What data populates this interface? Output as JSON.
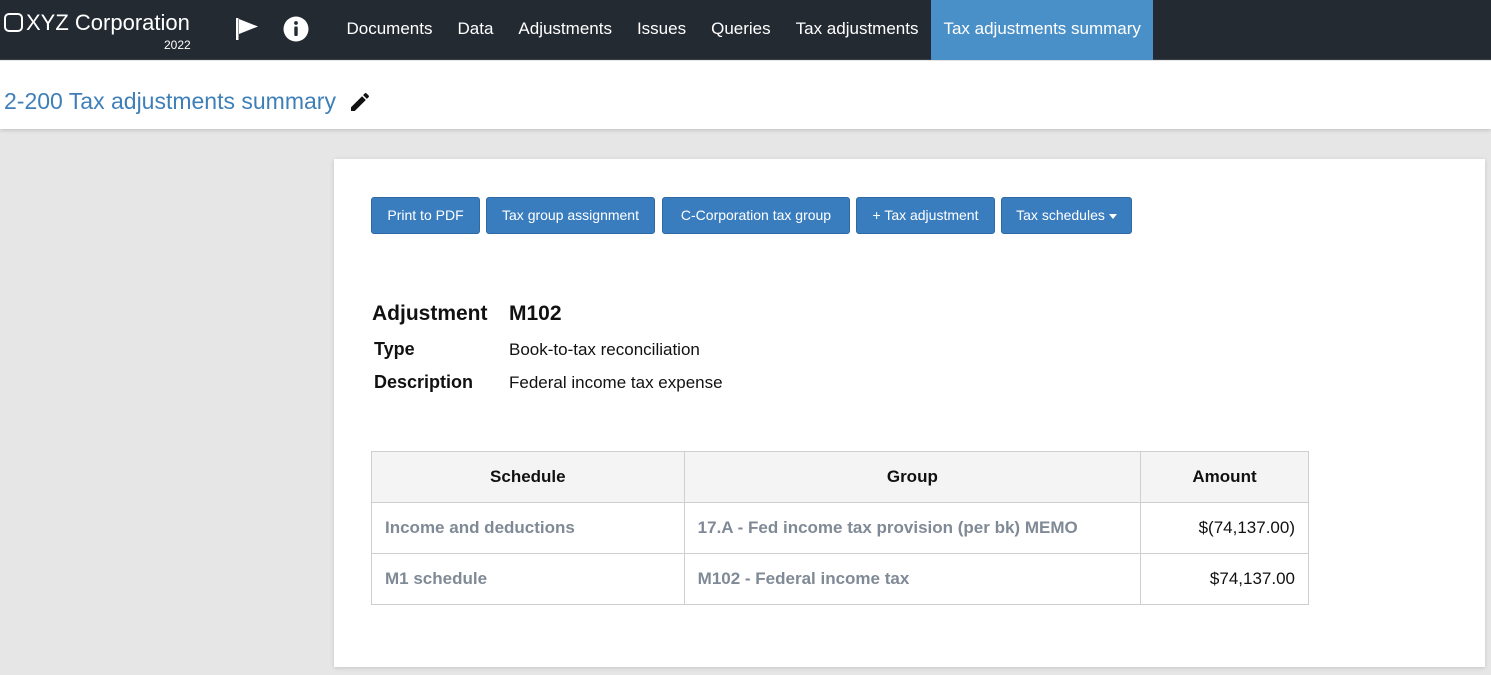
{
  "app": {
    "company": "XYZ Corporation",
    "year": "2022"
  },
  "icons": {
    "flag": "flag-icon",
    "info": "info-icon",
    "edit": "pencil-icon",
    "dropdown": "caret-down-icon"
  },
  "colors": {
    "nav_bg": "#232a32",
    "active_tab": "#4a90c8",
    "button": "#3a7dbf",
    "title": "#3f7fb8"
  },
  "nav": {
    "items": [
      "Documents",
      "Data",
      "Adjustments",
      "Issues",
      "Queries",
      "Tax adjustments",
      "Tax adjustments summary"
    ],
    "active": "Tax adjustments summary"
  },
  "page": {
    "title": "2-200 Tax adjustments summary"
  },
  "toolbar": {
    "print_pdf": "Print to PDF",
    "tax_group_assignment": "Tax group assignment",
    "c_corp_tax_group": "C-Corporation tax group",
    "add_tax_adjustment": "+ Tax adjustment",
    "tax_schedules": "Tax schedules"
  },
  "adjustment": {
    "label": "Adjustment",
    "code": "M102",
    "type_label": "Type",
    "type_value": "Book-to-tax reconciliation",
    "description_label": "Description",
    "description_value": "Federal income tax expense"
  },
  "table": {
    "headers": [
      "Schedule",
      "Group",
      "Amount"
    ],
    "rows": [
      [
        "Income and deductions",
        "17.A - Fed income tax provision (per bk) MEMO",
        "$(74,137.00)"
      ],
      [
        "M1 schedule",
        "M102 - Federal income tax",
        "$74,137.00"
      ]
    ]
  }
}
